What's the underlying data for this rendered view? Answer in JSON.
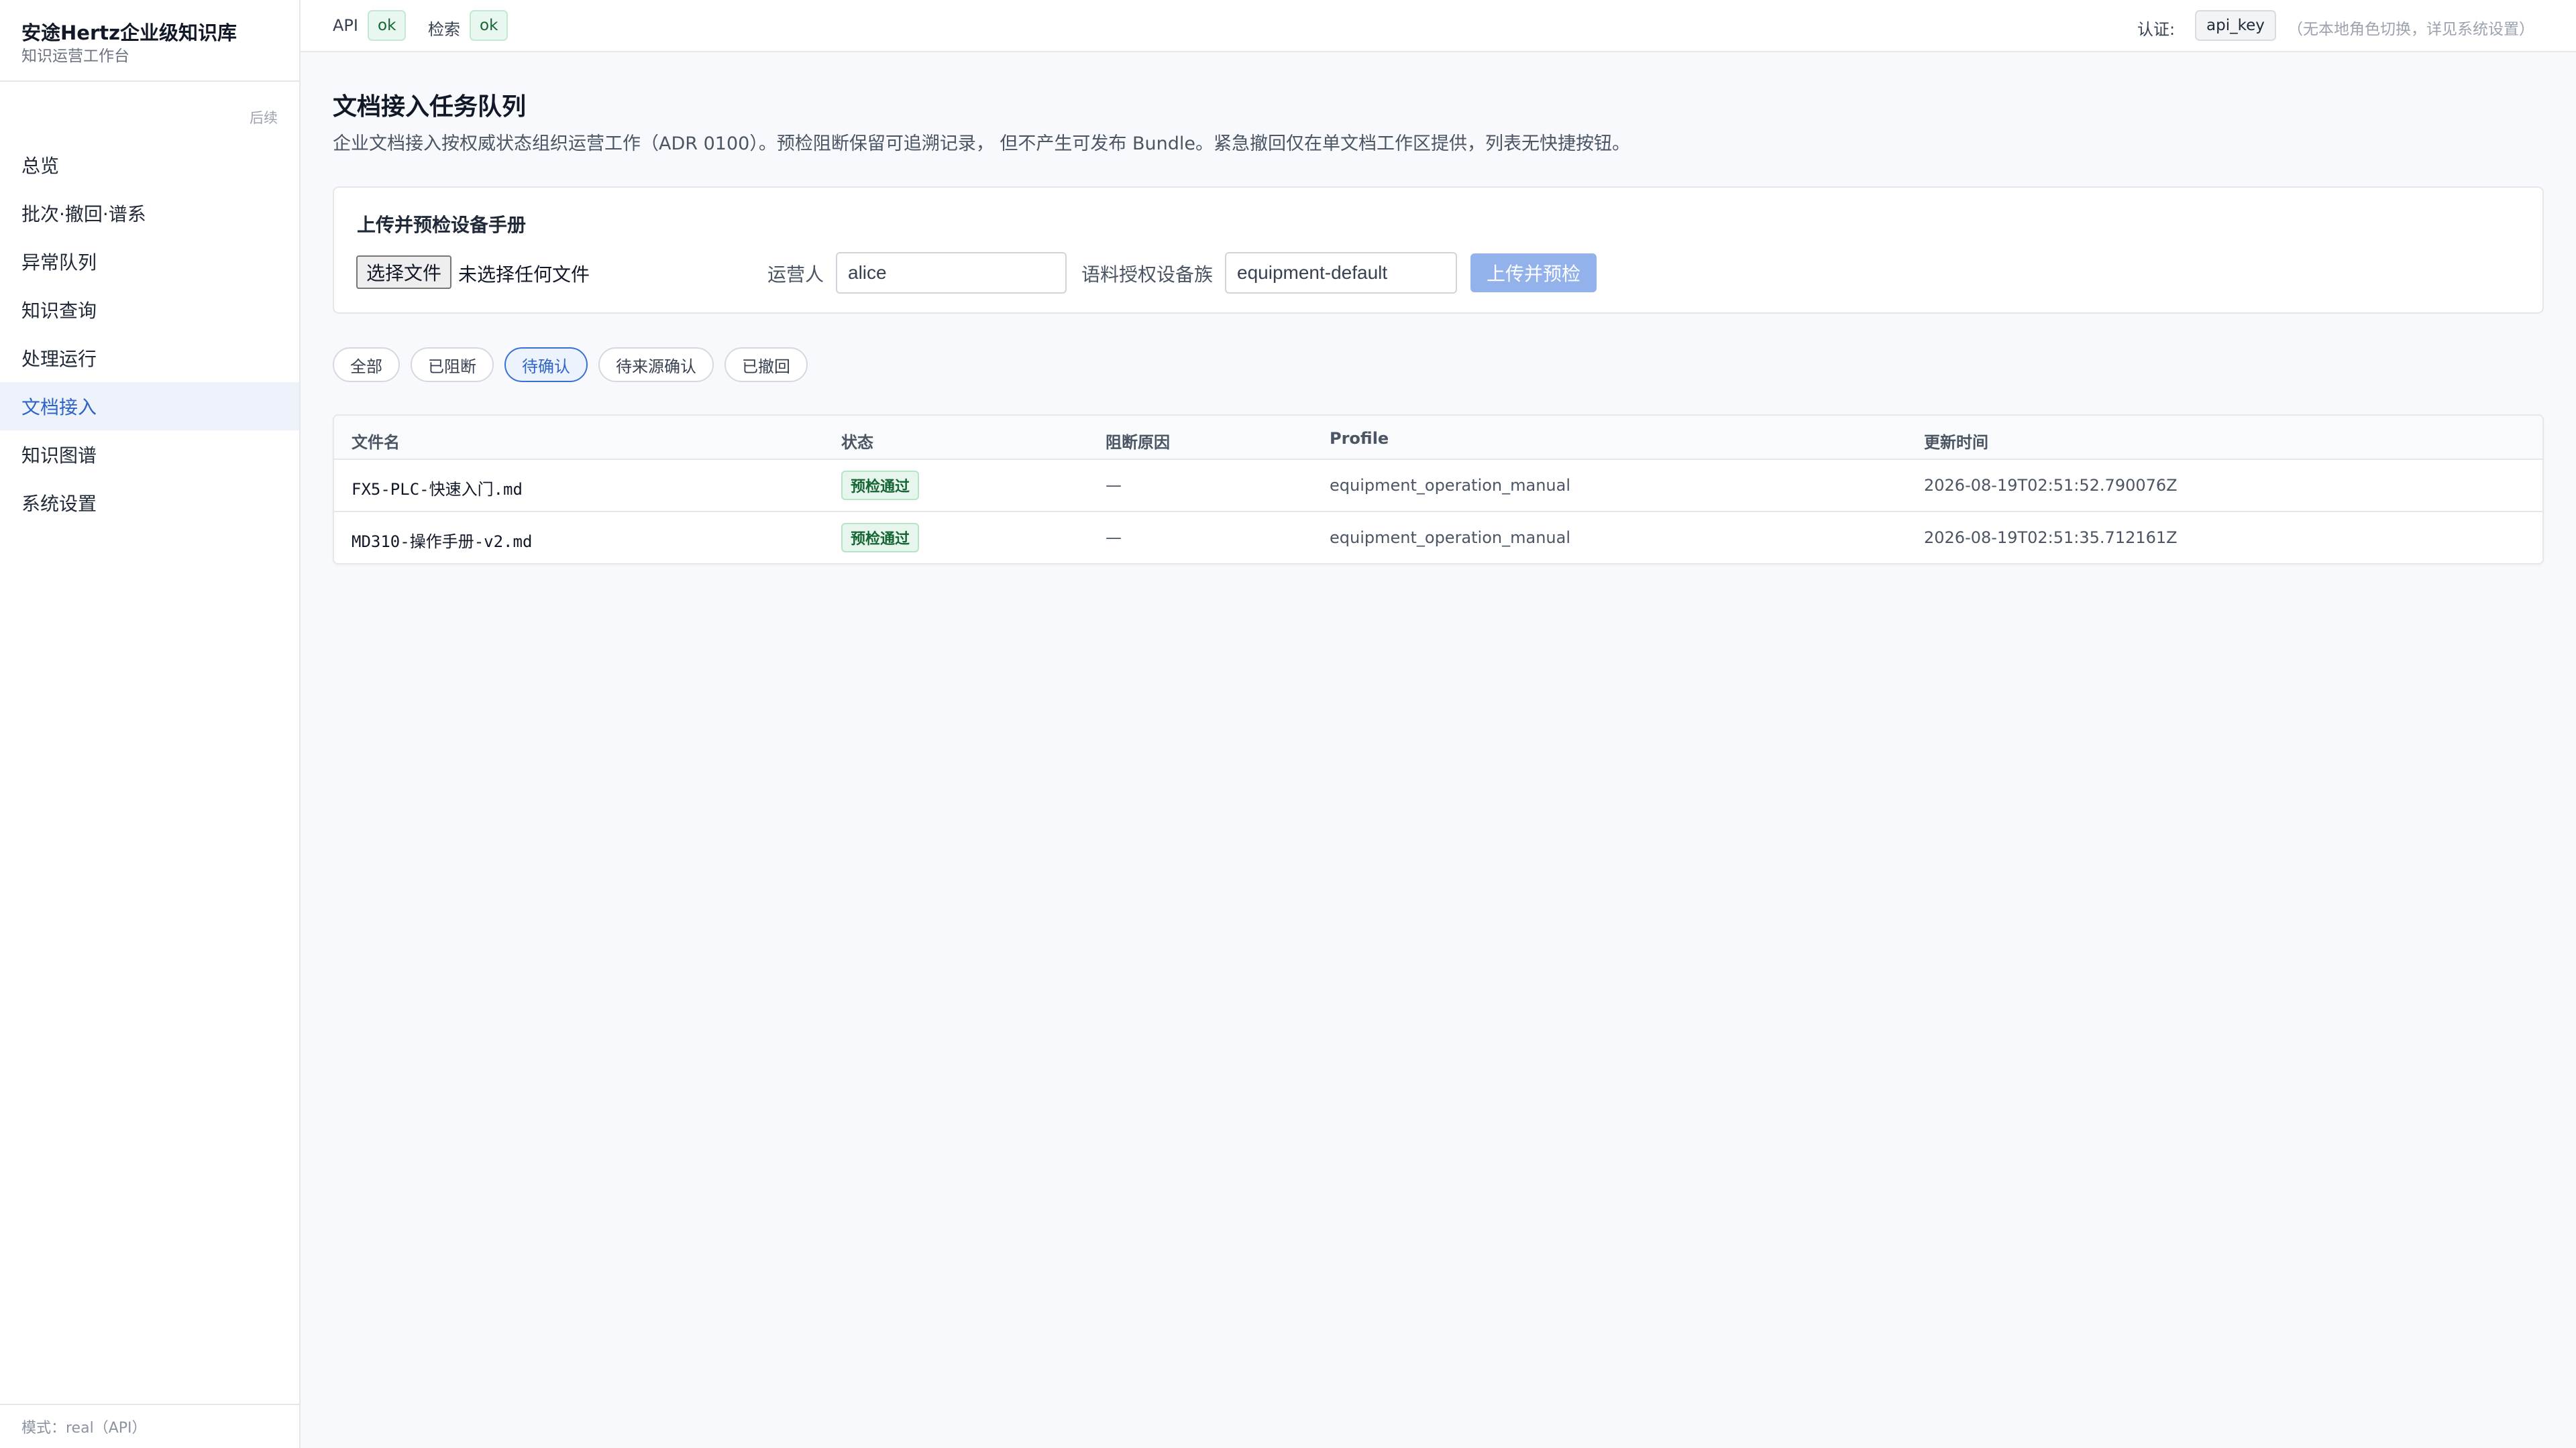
{
  "sidebar": {
    "brand_title": "安途Hertz企业级知识库",
    "brand_subtitle": "知识运营工作台",
    "collapse_label": "后续",
    "items": [
      {
        "label": "总览",
        "active": false
      },
      {
        "label": "批次·撤回·谱系",
        "active": false
      },
      {
        "label": "异常队列",
        "active": false
      },
      {
        "label": "知识查询",
        "active": false
      },
      {
        "label": "处理运行",
        "active": false
      },
      {
        "label": "文档接入",
        "active": true
      },
      {
        "label": "知识图谱",
        "active": false
      },
      {
        "label": "系统设置",
        "active": false
      }
    ],
    "footer": "模式：real（API）"
  },
  "topbar": {
    "api_label": "API",
    "api_status": "ok",
    "search_label": "检索",
    "search_status": "ok",
    "auth_label": "认证:",
    "auth_value": "api_key",
    "auth_note": "（无本地角色切换，详见系统设置）"
  },
  "page": {
    "title": "文档接入任务队列",
    "description": "企业文档接入按权威状态组织运营工作（ADR 0100）。预检阻断保留可追溯记录， 但不产生可发布 Bundle。紧急撤回仅在单文档工作区提供，列表无快捷按钮。"
  },
  "upload": {
    "title": "上传并预检设备手册",
    "file_button": "选择文件",
    "file_none": "未选择任何文件",
    "operator_label": "运营人",
    "operator_value": "alice",
    "family_label": "语料授权设备族",
    "family_value": "equipment-default",
    "submit_label": "上传并预检"
  },
  "filters": [
    {
      "label": "全部",
      "active": false
    },
    {
      "label": "已阻断",
      "active": false
    },
    {
      "label": "待确认",
      "active": true
    },
    {
      "label": "待来源确认",
      "active": false
    },
    {
      "label": "已撤回",
      "active": false
    }
  ],
  "table": {
    "columns": [
      "文件名",
      "状态",
      "阻断原因",
      "Profile",
      "更新时间"
    ],
    "rows": [
      {
        "filename": "FX5-PLC-快速入门.md",
        "status": "预检通过",
        "reason": "—",
        "profile": "equipment_operation_manual",
        "updated": "2026-08-19T02:51:52.790076Z"
      },
      {
        "filename": "MD310-操作手册-v2.md",
        "status": "预检通过",
        "reason": "—",
        "profile": "equipment_operation_manual",
        "updated": "2026-08-19T02:51:35.712161Z"
      }
    ]
  },
  "colors": {
    "accent": "#2f63c8",
    "accent_bg": "#eef3fb",
    "ok_bg": "#e8f7ef",
    "ok_text": "#166534",
    "submit_disabled": "#93b2ec"
  }
}
